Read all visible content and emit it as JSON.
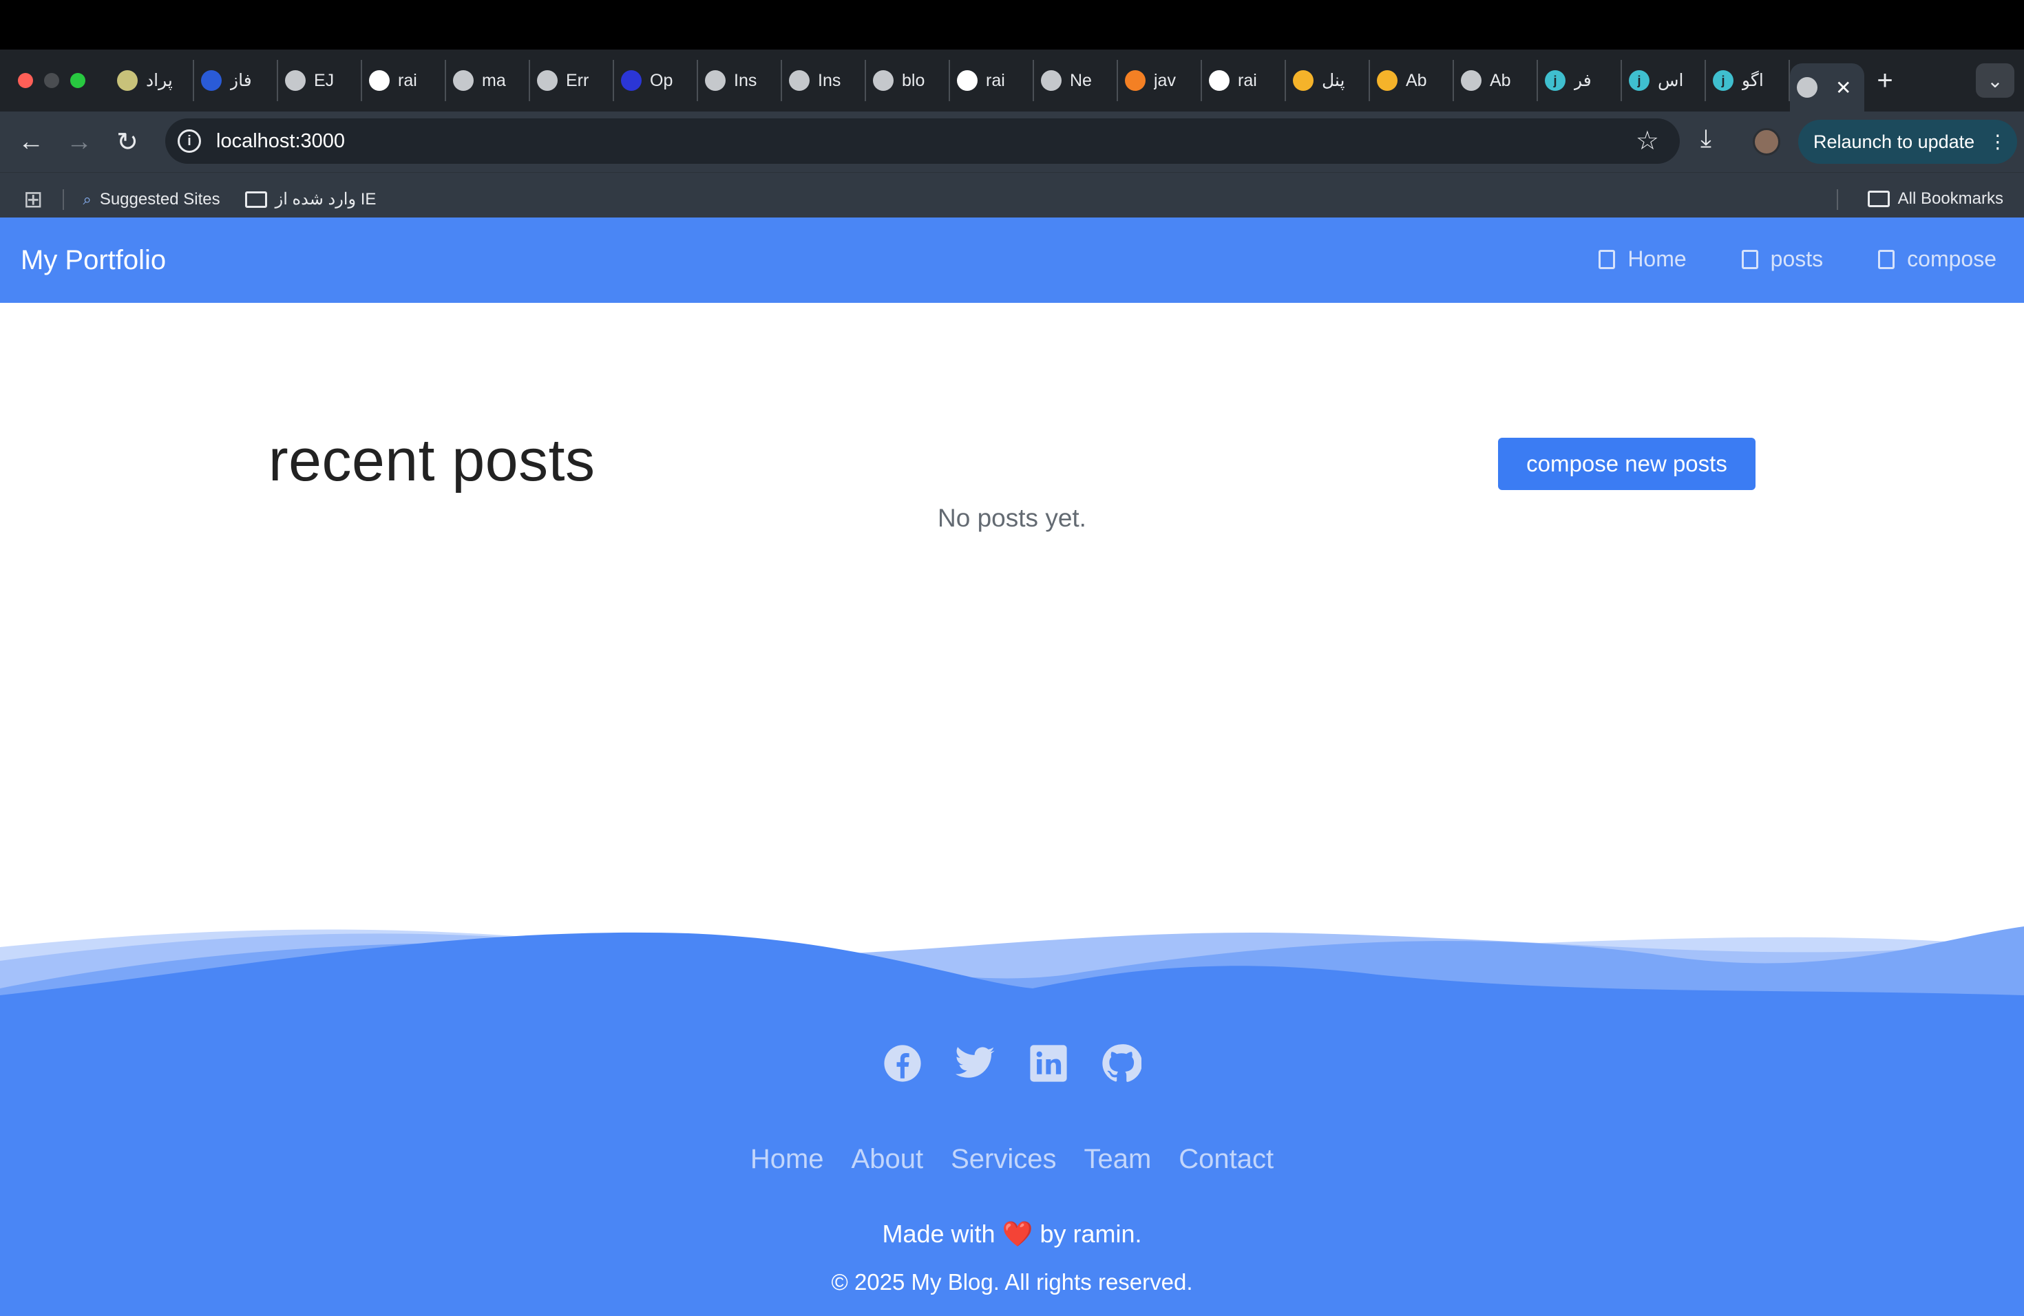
{
  "browser": {
    "tabs": [
      {
        "title": "پراد",
        "icon": "shield-icon"
      },
      {
        "title": "فاز",
        "icon": "chart-icon"
      },
      {
        "title": "EJ",
        "icon": "globe-icon"
      },
      {
        "title": "rai",
        "icon": "github-icon"
      },
      {
        "title": "ma",
        "icon": "globe-icon"
      },
      {
        "title": "Err",
        "icon": "globe-icon"
      },
      {
        "title": "Op",
        "icon": "openai-icon"
      },
      {
        "title": "Ins",
        "icon": "globe-icon"
      },
      {
        "title": "Ins",
        "icon": "globe-icon"
      },
      {
        "title": "blo",
        "icon": "globe-icon"
      },
      {
        "title": "rai",
        "icon": "github-icon"
      },
      {
        "title": "Ne",
        "icon": "chrome-icon"
      },
      {
        "title": "jav",
        "icon": "stackoverflow-icon"
      },
      {
        "title": "rai",
        "icon": "github-icon"
      },
      {
        "title": "پنل",
        "icon": "vuetify-icon"
      },
      {
        "title": "Ab",
        "icon": "vuetify-icon"
      },
      {
        "title": "Ab",
        "icon": "globe-icon"
      },
      {
        "title": "فر",
        "icon": "j-icon"
      },
      {
        "title": "اس",
        "icon": "j-icon"
      },
      {
        "title": "اگو",
        "icon": "j-icon"
      }
    ],
    "active_tab_close": "✕",
    "new_tab": "+",
    "url": "localhost:3000",
    "relaunch_label": "Relaunch to update",
    "bookmarks": {
      "suggested": "Suggested Sites",
      "imported": "وارد شده از IE",
      "all": "All Bookmarks"
    }
  },
  "site": {
    "brand": "My Portfolio",
    "nav": [
      {
        "label": "Home",
        "icon": "copy-icon"
      },
      {
        "label": "posts",
        "icon": "copy-icon"
      },
      {
        "label": "compose",
        "icon": "calendar-icon"
      }
    ],
    "heading": "recent posts",
    "compose_button": "compose new posts",
    "empty_message": "No posts yet.",
    "footer": {
      "socials": [
        "facebook-icon",
        "twitter-icon",
        "linkedin-icon",
        "github-icon"
      ],
      "links": [
        "Home",
        "About",
        "Services",
        "Team",
        "Contact"
      ],
      "made_with_pre": "Made with",
      "heart": "❤️",
      "made_with_post": "by ramin.",
      "copyright": "© 2025 My Blog. All rights reserved."
    },
    "colors": {
      "primary": "#4a86f5",
      "button": "#3b7cf3"
    }
  }
}
